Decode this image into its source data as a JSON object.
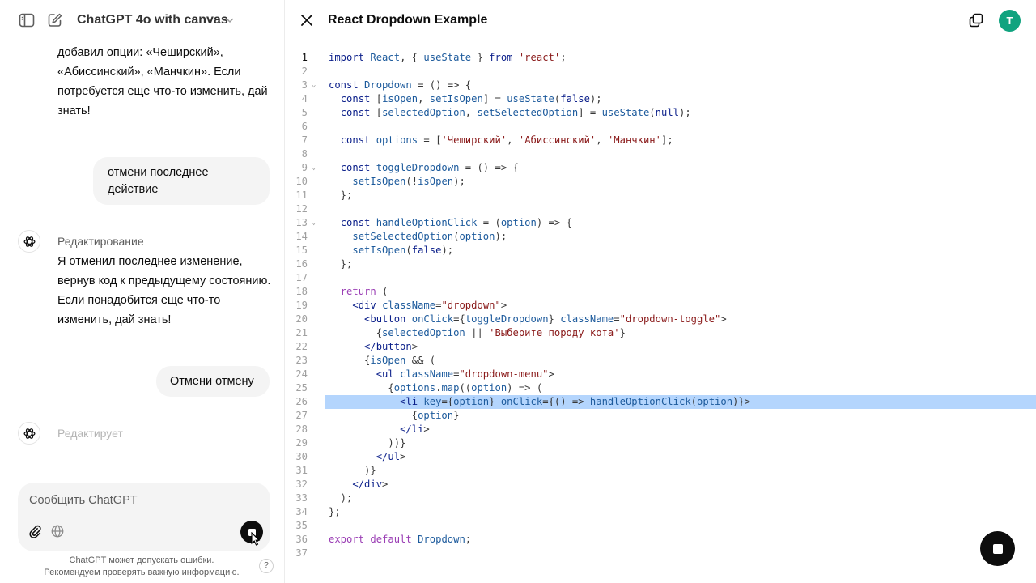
{
  "header": {
    "model_title": "ChatGPT 4o with canvas"
  },
  "chat": {
    "assistant_message_1": "добавил опции: «Чеширский»,\n«Абиссинский», «Манчкин». Если\nпотребуется еще что-то изменить, дай\nзнать!",
    "user_message_1": "отмени последнее\nдействие",
    "editing_label_1": "Редактирование",
    "assistant_message_2": "Я отменил последнее изменение,\nвернув код к предыдущему состоянию.\nЕсли понадобится еще что-то\nизменить, дай знать!",
    "user_message_2": "Отмени отмену",
    "editing_label_2": "Редактирует"
  },
  "composer": {
    "placeholder": "Сообщить ChatGPT"
  },
  "footer": {
    "disclaimer": "ChatGPT может допускать ошибки.\nРекомендуем проверять важную информацию.",
    "help": "?"
  },
  "canvas": {
    "title": "React Dropdown Example",
    "user_initial": "T",
    "code_lines": [
      "import React, { useState } from 'react';",
      "",
      "const Dropdown = () => {",
      "  const [isOpen, setIsOpen] = useState(false);",
      "  const [selectedOption, setSelectedOption] = useState(null);",
      "",
      "  const options = ['Чеширский', 'Абиссинский', 'Манчкин'];",
      "",
      "  const toggleDropdown = () => {",
      "    setIsOpen(!isOpen);",
      "  };",
      "",
      "  const handleOptionClick = (option) => {",
      "    setSelectedOption(option);",
      "    setIsOpen(false);",
      "  };",
      "",
      "  return (",
      "    <div className=\"dropdown\">",
      "      <button onClick={toggleDropdown} className=\"dropdown-toggle\">",
      "        {selectedOption || 'Выберите породу кота'}",
      "      </button>",
      "      {isOpen && (",
      "        <ul className=\"dropdown-menu\">",
      "          {options.map((option) => (",
      "            <li key={option} onClick={() => handleOptionClick(option)}>",
      "              {option}",
      "            </li>",
      "          ))}",
      "        </ul>",
      "      )}",
      "    </div>",
      "  );",
      "};",
      "",
      "export default Dropdown;",
      ""
    ],
    "fold_lines": [
      3,
      9,
      13
    ],
    "highlighted_line": 26,
    "current_line": 1
  }
}
